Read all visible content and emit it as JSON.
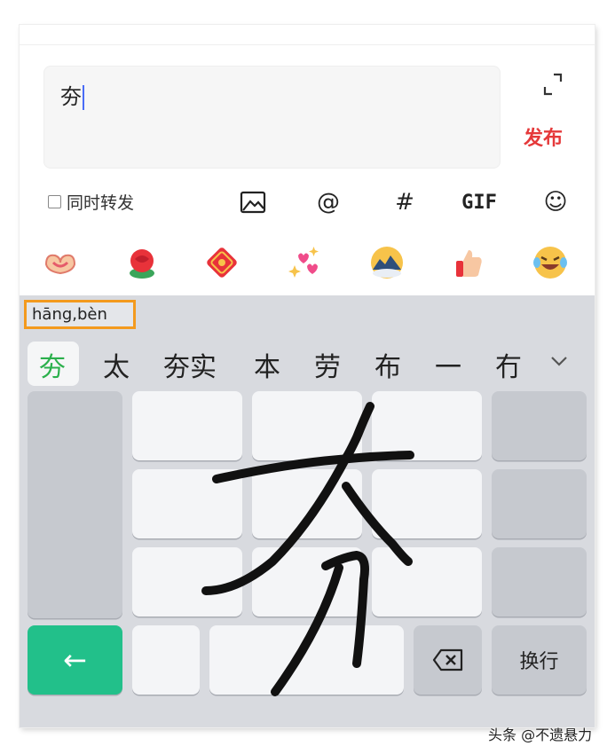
{
  "compose": {
    "text": "夯"
  },
  "actions": {
    "publish_label": "发布",
    "sync_label": "同时转发"
  },
  "toolbar": {
    "mention": "@",
    "hashtag": "#",
    "gif": "GIF",
    "emoji": "☺"
  },
  "emoji_icons": [
    "heart-hands-icon",
    "rose-icon",
    "red-envelope-icon",
    "sparkling-hearts-icon",
    "landscape-sticker-icon",
    "thumbs-up-icon",
    "laughing-crying-icon"
  ],
  "keyboard": {
    "pinyin": "hāng,bèn",
    "candidates": [
      "夯",
      "太",
      "夯实",
      "本",
      "劳",
      "布",
      "一",
      "冇"
    ],
    "newline_label": "换行",
    "enter_symbol": "←",
    "handwriting": "夯"
  },
  "watermark": "头条 @不遗悬力",
  "colors": {
    "publish": "#e5393a",
    "accent_green": "#22c08a",
    "candidate_selected": "#2bb04c",
    "highlight_box": "#f39a1e",
    "caret": "#4a6cf7"
  }
}
